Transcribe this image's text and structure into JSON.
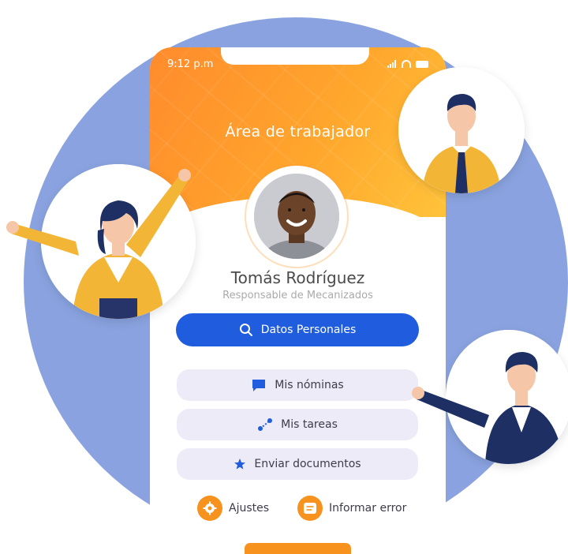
{
  "status_bar": {
    "time": "9:12 p.m"
  },
  "header": {
    "title": "Área de trabajador"
  },
  "profile": {
    "name": "Tomás Rodríguez",
    "role": "Responsable de Mecanizados"
  },
  "primary_action": {
    "label": "Datos Personales",
    "icon": "search-icon"
  },
  "menu": [
    {
      "label": "Mis nóminas",
      "icon": "chat-icon"
    },
    {
      "label": "Mis tareas",
      "icon": "tasks-icon"
    },
    {
      "label": "Enviar documentos",
      "icon": "star-icon"
    }
  ],
  "bottom_actions": [
    {
      "label": "Ajustes",
      "icon": "gear-icon"
    },
    {
      "label": "Informar error",
      "icon": "message-icon"
    }
  ],
  "colors": {
    "background_circle": "#8aa3e0",
    "header_gradient_start": "#ff8b2c",
    "header_gradient_end": "#ffc33a",
    "primary": "#1f5cde",
    "accent": "#f7921e",
    "menu_bg": "#eeebf8"
  }
}
